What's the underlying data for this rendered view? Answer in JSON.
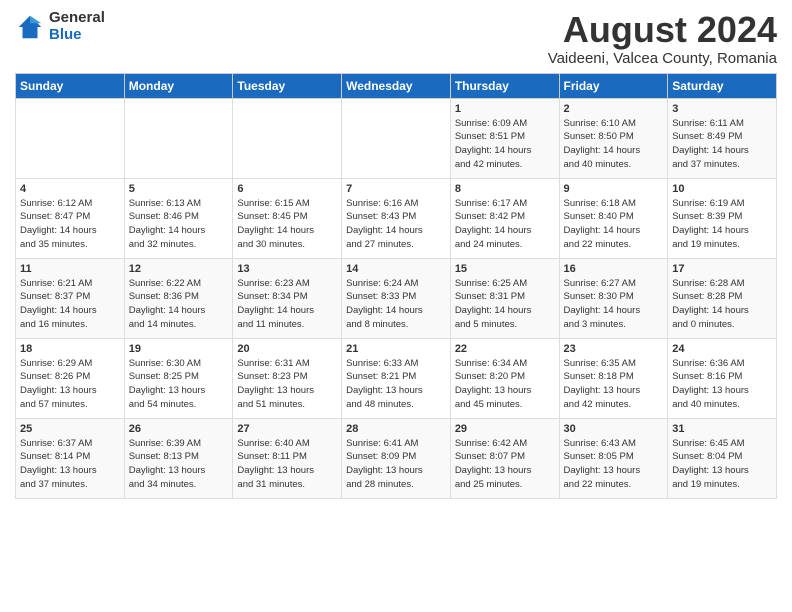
{
  "logo": {
    "general": "General",
    "blue": "Blue"
  },
  "title": "August 2024",
  "location": "Vaideeni, Valcea County, Romania",
  "headers": [
    "Sunday",
    "Monday",
    "Tuesday",
    "Wednesday",
    "Thursday",
    "Friday",
    "Saturday"
  ],
  "weeks": [
    [
      {
        "day": "",
        "info": ""
      },
      {
        "day": "",
        "info": ""
      },
      {
        "day": "",
        "info": ""
      },
      {
        "day": "",
        "info": ""
      },
      {
        "day": "1",
        "info": "Sunrise: 6:09 AM\nSunset: 8:51 PM\nDaylight: 14 hours\nand 42 minutes."
      },
      {
        "day": "2",
        "info": "Sunrise: 6:10 AM\nSunset: 8:50 PM\nDaylight: 14 hours\nand 40 minutes."
      },
      {
        "day": "3",
        "info": "Sunrise: 6:11 AM\nSunset: 8:49 PM\nDaylight: 14 hours\nand 37 minutes."
      }
    ],
    [
      {
        "day": "4",
        "info": "Sunrise: 6:12 AM\nSunset: 8:47 PM\nDaylight: 14 hours\nand 35 minutes."
      },
      {
        "day": "5",
        "info": "Sunrise: 6:13 AM\nSunset: 8:46 PM\nDaylight: 14 hours\nand 32 minutes."
      },
      {
        "day": "6",
        "info": "Sunrise: 6:15 AM\nSunset: 8:45 PM\nDaylight: 14 hours\nand 30 minutes."
      },
      {
        "day": "7",
        "info": "Sunrise: 6:16 AM\nSunset: 8:43 PM\nDaylight: 14 hours\nand 27 minutes."
      },
      {
        "day": "8",
        "info": "Sunrise: 6:17 AM\nSunset: 8:42 PM\nDaylight: 14 hours\nand 24 minutes."
      },
      {
        "day": "9",
        "info": "Sunrise: 6:18 AM\nSunset: 8:40 PM\nDaylight: 14 hours\nand 22 minutes."
      },
      {
        "day": "10",
        "info": "Sunrise: 6:19 AM\nSunset: 8:39 PM\nDaylight: 14 hours\nand 19 minutes."
      }
    ],
    [
      {
        "day": "11",
        "info": "Sunrise: 6:21 AM\nSunset: 8:37 PM\nDaylight: 14 hours\nand 16 minutes."
      },
      {
        "day": "12",
        "info": "Sunrise: 6:22 AM\nSunset: 8:36 PM\nDaylight: 14 hours\nand 14 minutes."
      },
      {
        "day": "13",
        "info": "Sunrise: 6:23 AM\nSunset: 8:34 PM\nDaylight: 14 hours\nand 11 minutes."
      },
      {
        "day": "14",
        "info": "Sunrise: 6:24 AM\nSunset: 8:33 PM\nDaylight: 14 hours\nand 8 minutes."
      },
      {
        "day": "15",
        "info": "Sunrise: 6:25 AM\nSunset: 8:31 PM\nDaylight: 14 hours\nand 5 minutes."
      },
      {
        "day": "16",
        "info": "Sunrise: 6:27 AM\nSunset: 8:30 PM\nDaylight: 14 hours\nand 3 minutes."
      },
      {
        "day": "17",
        "info": "Sunrise: 6:28 AM\nSunset: 8:28 PM\nDaylight: 14 hours\nand 0 minutes."
      }
    ],
    [
      {
        "day": "18",
        "info": "Sunrise: 6:29 AM\nSunset: 8:26 PM\nDaylight: 13 hours\nand 57 minutes."
      },
      {
        "day": "19",
        "info": "Sunrise: 6:30 AM\nSunset: 8:25 PM\nDaylight: 13 hours\nand 54 minutes."
      },
      {
        "day": "20",
        "info": "Sunrise: 6:31 AM\nSunset: 8:23 PM\nDaylight: 13 hours\nand 51 minutes."
      },
      {
        "day": "21",
        "info": "Sunrise: 6:33 AM\nSunset: 8:21 PM\nDaylight: 13 hours\nand 48 minutes."
      },
      {
        "day": "22",
        "info": "Sunrise: 6:34 AM\nSunset: 8:20 PM\nDaylight: 13 hours\nand 45 minutes."
      },
      {
        "day": "23",
        "info": "Sunrise: 6:35 AM\nSunset: 8:18 PM\nDaylight: 13 hours\nand 42 minutes."
      },
      {
        "day": "24",
        "info": "Sunrise: 6:36 AM\nSunset: 8:16 PM\nDaylight: 13 hours\nand 40 minutes."
      }
    ],
    [
      {
        "day": "25",
        "info": "Sunrise: 6:37 AM\nSunset: 8:14 PM\nDaylight: 13 hours\nand 37 minutes."
      },
      {
        "day": "26",
        "info": "Sunrise: 6:39 AM\nSunset: 8:13 PM\nDaylight: 13 hours\nand 34 minutes."
      },
      {
        "day": "27",
        "info": "Sunrise: 6:40 AM\nSunset: 8:11 PM\nDaylight: 13 hours\nand 31 minutes."
      },
      {
        "day": "28",
        "info": "Sunrise: 6:41 AM\nSunset: 8:09 PM\nDaylight: 13 hours\nand 28 minutes."
      },
      {
        "day": "29",
        "info": "Sunrise: 6:42 AM\nSunset: 8:07 PM\nDaylight: 13 hours\nand 25 minutes."
      },
      {
        "day": "30",
        "info": "Sunrise: 6:43 AM\nSunset: 8:05 PM\nDaylight: 13 hours\nand 22 minutes."
      },
      {
        "day": "31",
        "info": "Sunrise: 6:45 AM\nSunset: 8:04 PM\nDaylight: 13 hours\nand 19 minutes."
      }
    ]
  ]
}
